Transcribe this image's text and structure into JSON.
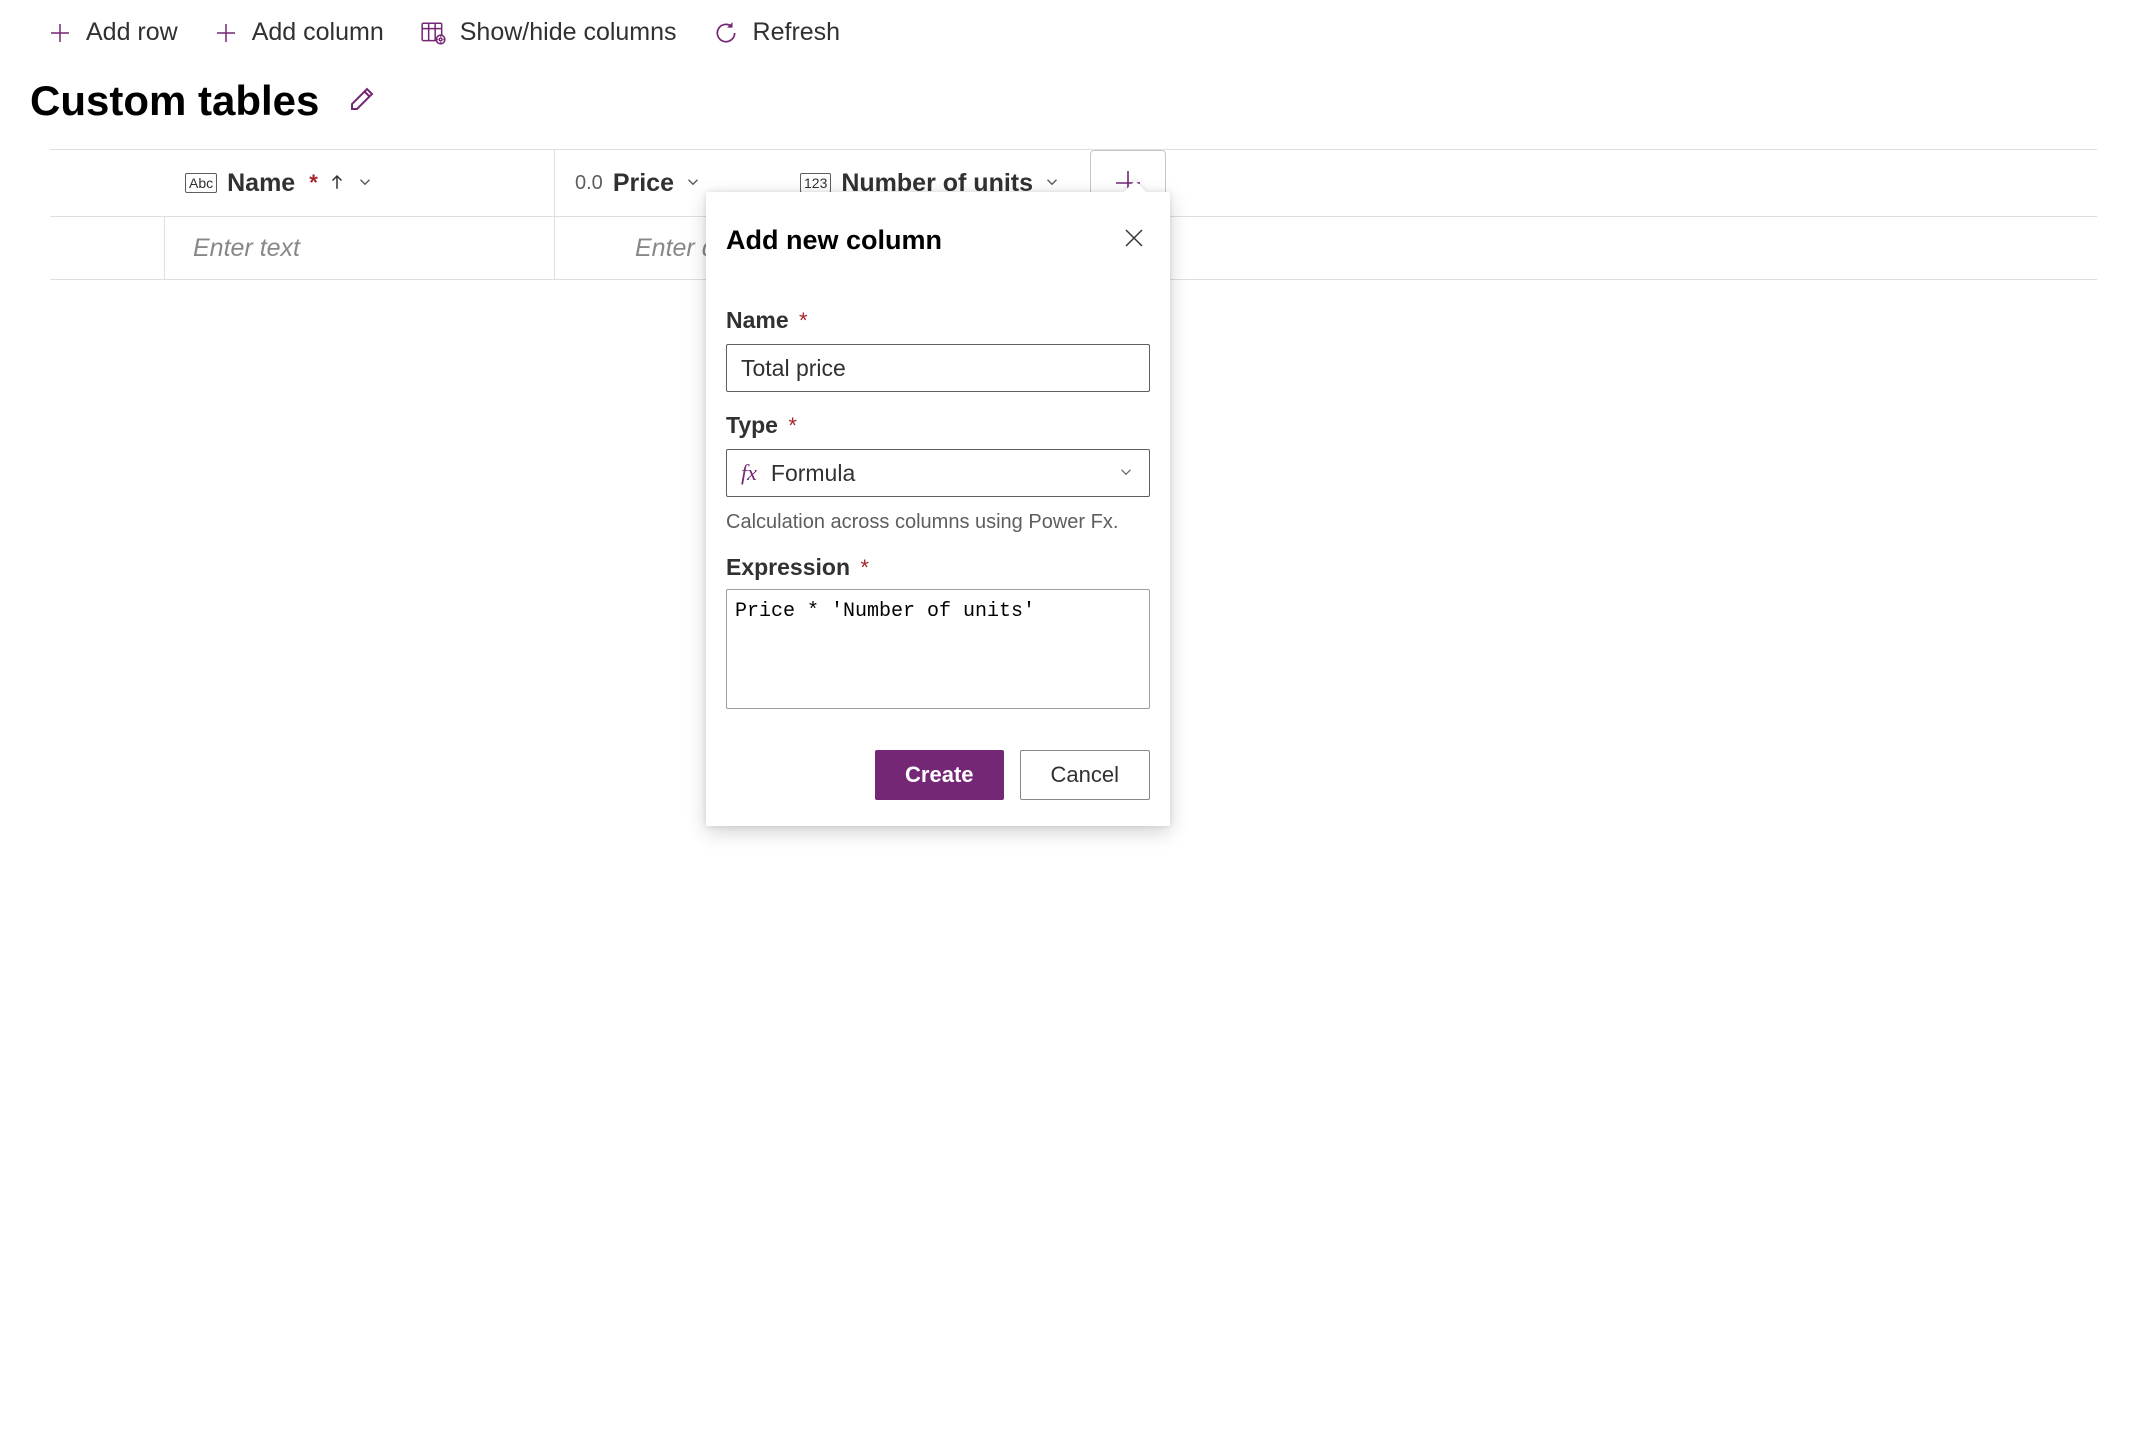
{
  "toolbar": {
    "add_row": "Add row",
    "add_column": "Add column",
    "show_hide": "Show/hide columns",
    "refresh": "Refresh"
  },
  "page_title": "Custom tables",
  "columns": [
    {
      "type_badge": "Abc",
      "label": "Name",
      "required": true,
      "sorted_asc": true
    },
    {
      "type_badge": "0.0",
      "label": "Price"
    },
    {
      "type_badge": "123",
      "label": "Number of units"
    }
  ],
  "row_placeholders": {
    "name": "Enter text",
    "price": "Enter de"
  },
  "panel": {
    "title": "Add new column",
    "name_label": "Name",
    "name_value": "Total price",
    "type_label": "Type",
    "type_value": "Formula",
    "type_help": "Calculation across columns using Power Fx.",
    "expression_label": "Expression",
    "expression_value": "Price * 'Number of units'",
    "create_label": "Create",
    "cancel_label": "Cancel"
  }
}
